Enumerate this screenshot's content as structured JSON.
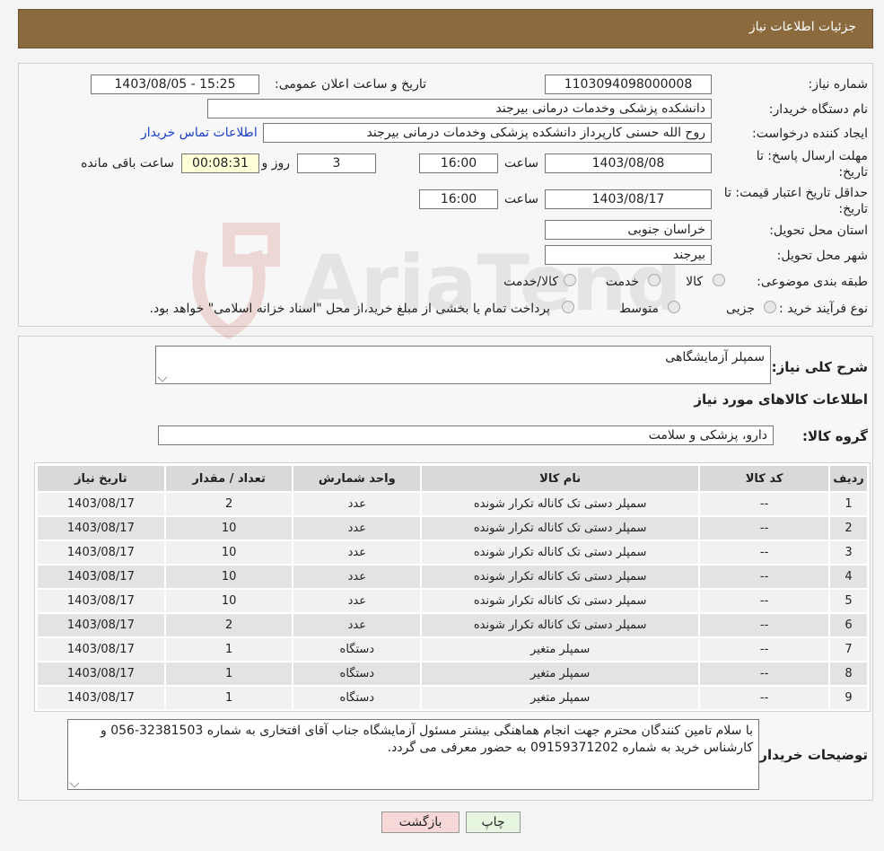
{
  "header": {
    "title": "جزئیات اطلاعات نیاز"
  },
  "form": {
    "need_number": {
      "label": "شماره نیاز:",
      "value": "1103094098000008"
    },
    "announce_datetime": {
      "label": "تاریخ و ساعت اعلان عمومی:",
      "value": "1403/08/05 - 15:25"
    },
    "buyer_org": {
      "label": "نام دستگاه خریدار:",
      "value": "دانشکده پزشکی  وخدمات درمانی بیرجند"
    },
    "creator": {
      "label": "ایجاد کننده درخواست:",
      "value": "روح الله حسنی کارپرداز دانشکده پزشکی  وخدمات درمانی بیرجند",
      "contact_link": "اطلاعات تماس خریدار"
    },
    "reply_deadline": {
      "label_line1": "مهلت ارسال پاسخ: تا",
      "label_line2": "تاریخ:",
      "date": "1403/08/08",
      "time_label": "ساعت",
      "time": "16:00",
      "days": "3",
      "days_label": "روز و",
      "remaining": "00:08:31",
      "remaining_label": "ساعت باقی مانده"
    },
    "price_validity": {
      "label_line1": "حداقل تاریخ اعتبار قیمت: تا",
      "label_line2": "تاریخ:",
      "date": "1403/08/17",
      "time_label": "ساعت",
      "time": "16:00"
    },
    "province": {
      "label": "استان محل تحویل:",
      "value": "خراسان جنوبی"
    },
    "city": {
      "label": "شهر محل تحویل:",
      "value": "بیرجند"
    },
    "category": {
      "label": "طبقه بندی موضوعی:",
      "options": [
        "کالا",
        "خدمت",
        "کالا/خدمت"
      ]
    },
    "purchase_type": {
      "label": "نوع فرآیند خرید :",
      "options": [
        "جزیی",
        "متوسط"
      ],
      "note": "پرداخت تمام یا بخشی از مبلغ خرید،از محل \"اسناد خزانه اسلامی\" خواهد بود."
    }
  },
  "description": {
    "label": "شرح کلی نیاز:",
    "value": "سمپلر آزمایشگاهی"
  },
  "goods_section": {
    "title": "اطلاعات کالاهای مورد نیاز",
    "group_label": "گروه کالا:",
    "group_value": "دارو، پزشکی و سلامت"
  },
  "table": {
    "headers": [
      "ردیف",
      "کد کالا",
      "نام کالا",
      "واحد شمارش",
      "تعداد / مقدار",
      "تاریخ نیاز"
    ],
    "rows": [
      [
        "1",
        "--",
        "سمپلر دستی تک کاناله تکرار شونده",
        "عدد",
        "2",
        "1403/08/17"
      ],
      [
        "2",
        "--",
        "سمپلر دستی تک کاناله تکرار شونده",
        "عدد",
        "10",
        "1403/08/17"
      ],
      [
        "3",
        "--",
        "سمپلر دستی تک کاناله تکرار شونده",
        "عدد",
        "10",
        "1403/08/17"
      ],
      [
        "4",
        "--",
        "سمپلر دستی تک کاناله تکرار شونده",
        "عدد",
        "10",
        "1403/08/17"
      ],
      [
        "5",
        "--",
        "سمپلر دستی تک کاناله تکرار شونده",
        "عدد",
        "10",
        "1403/08/17"
      ],
      [
        "6",
        "--",
        "سمپلر دستی تک کاناله تکرار شونده",
        "عدد",
        "2",
        "1403/08/17"
      ],
      [
        "7",
        "--",
        "سمپلر متغیر",
        "دستگاه",
        "1",
        "1403/08/17"
      ],
      [
        "8",
        "--",
        "سمپلر متغیر",
        "دستگاه",
        "1",
        "1403/08/17"
      ],
      [
        "9",
        "--",
        "سمپلر متغیر",
        "دستگاه",
        "1",
        "1403/08/17"
      ]
    ]
  },
  "buyer_notes": {
    "label": "توضیحات خریدار:",
    "value": "با سلام تامین کنندگان محترم جهت انجام هماهنگی بیشتر مسئول آزمایشگاه جناب آقای افتخاری به شماره 32381503-056 و کارشناس خرید به شماره 09159371202 به حضور معرفی می گردد."
  },
  "buttons": {
    "print": "چاپ",
    "back": "بازگشت"
  },
  "watermark": {
    "text": "AriaTender.neT"
  },
  "colors": {
    "header_bg": "#8b6a3e",
    "link": "#1a3fc7",
    "back_button": "#f8d7d7",
    "print_button": "#e6f6e0"
  }
}
